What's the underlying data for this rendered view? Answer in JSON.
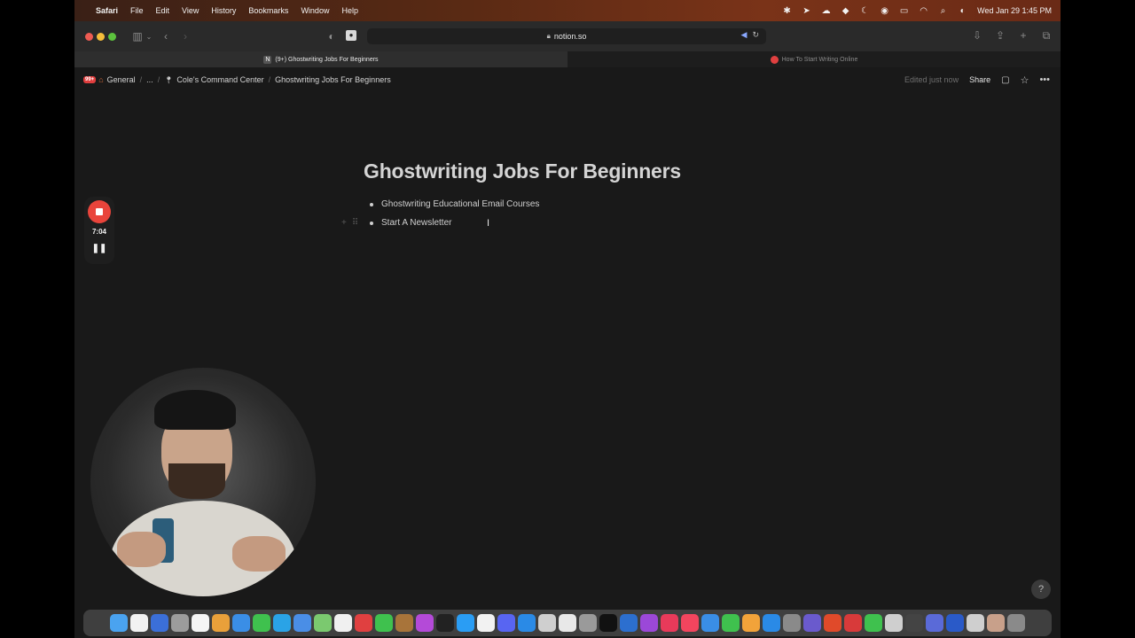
{
  "menubar": {
    "app": "Safari",
    "items": [
      "File",
      "Edit",
      "View",
      "History",
      "Bookmarks",
      "Window",
      "Help"
    ],
    "clock": "Wed Jan 29  1:45 PM"
  },
  "toolbar": {
    "url": "notion.so"
  },
  "tabs": [
    {
      "label": "(9+) Ghostwriting Jobs For Beginners",
      "active": true
    },
    {
      "label": "How To Start Writing Online",
      "active": false
    }
  ],
  "notion": {
    "badge": "99+",
    "breadcrumbs": [
      "General",
      "...",
      "Cole's Command Center",
      "Ghostwriting Jobs For Beginners"
    ],
    "edited": "Edited just now",
    "share": "Share"
  },
  "page": {
    "title": "Ghostwriting Jobs For Beginners",
    "bullets": [
      "Ghostwriting Educational Email Courses",
      "Start A Newsletter"
    ]
  },
  "recorder": {
    "time": "7:04"
  },
  "colors": {
    "background": "#191919",
    "record_red": "#e9443b",
    "badge_red": "#e03e3e"
  }
}
